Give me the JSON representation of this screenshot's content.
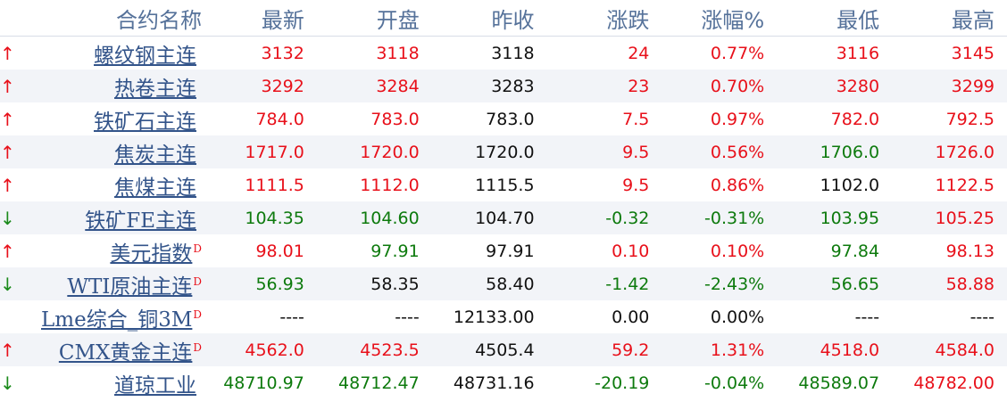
{
  "headers": {
    "name": "合约名称",
    "last": "最新",
    "open": "开盘",
    "prev": "昨收",
    "change": "涨跌",
    "pct": "涨幅%",
    "low": "最低",
    "high": "最高"
  },
  "colors": {
    "up": "#e8101a",
    "down": "#0d7a0d",
    "flat": "#111111",
    "header": "#56729a",
    "link": "#33548a"
  },
  "rows": [
    {
      "trend": "up",
      "arrow": "↑",
      "name": "螺纹钢主连",
      "tag": "",
      "last": "3132",
      "open": "3118",
      "prev": "3118",
      "change": "24",
      "pct": "0.77%",
      "low": "3116",
      "high": "3145",
      "c_last": "red",
      "c_open": "red",
      "c_change": "red",
      "c_pct": "red",
      "c_low": "red",
      "c_high": "red"
    },
    {
      "trend": "up",
      "arrow": "↑",
      "name": "热卷主连",
      "tag": "",
      "last": "3292",
      "open": "3284",
      "prev": "3283",
      "change": "23",
      "pct": "0.70%",
      "low": "3280",
      "high": "3299",
      "c_last": "red",
      "c_open": "red",
      "c_change": "red",
      "c_pct": "red",
      "c_low": "red",
      "c_high": "red"
    },
    {
      "trend": "up",
      "arrow": "↑",
      "name": "铁矿石主连",
      "tag": "",
      "last": "784.0",
      "open": "783.0",
      "prev": "783.0",
      "change": "7.5",
      "pct": "0.97%",
      "low": "782.0",
      "high": "792.5",
      "c_last": "red",
      "c_open": "red",
      "c_change": "red",
      "c_pct": "red",
      "c_low": "red",
      "c_high": "red"
    },
    {
      "trend": "up",
      "arrow": "↑",
      "name": "焦炭主连",
      "tag": "",
      "last": "1717.0",
      "open": "1720.0",
      "prev": "1720.0",
      "change": "9.5",
      "pct": "0.56%",
      "low": "1706.0",
      "high": "1726.0",
      "c_last": "red",
      "c_open": "red",
      "c_change": "red",
      "c_pct": "red",
      "c_low": "green",
      "c_high": "red"
    },
    {
      "trend": "up",
      "arrow": "↑",
      "name": "焦煤主连",
      "tag": "",
      "last": "1111.5",
      "open": "1112.0",
      "prev": "1115.5",
      "change": "9.5",
      "pct": "0.86%",
      "low": "1102.0",
      "high": "1122.5",
      "c_last": "red",
      "c_open": "red",
      "c_change": "red",
      "c_pct": "red",
      "c_low": "black",
      "c_high": "red"
    },
    {
      "trend": "down",
      "arrow": "↓",
      "name": "铁矿FE主连",
      "tag": "",
      "last": "104.35",
      "open": "104.60",
      "prev": "104.70",
      "change": "-0.32",
      "pct": "-0.31%",
      "low": "103.95",
      "high": "105.25",
      "c_last": "green",
      "c_open": "green",
      "c_change": "green",
      "c_pct": "green",
      "c_low": "green",
      "c_high": "red"
    },
    {
      "trend": "up",
      "arrow": "↑",
      "name": "美元指数",
      "tag": "D",
      "last": "98.01",
      "open": "97.91",
      "prev": "97.91",
      "change": "0.10",
      "pct": "0.10%",
      "low": "97.84",
      "high": "98.13",
      "c_last": "red",
      "c_open": "green",
      "c_change": "red",
      "c_pct": "red",
      "c_low": "green",
      "c_high": "red"
    },
    {
      "trend": "down",
      "arrow": "↓",
      "name": "WTI原油主连",
      "tag": "D",
      "last": "56.93",
      "open": "58.35",
      "prev": "58.40",
      "change": "-1.42",
      "pct": "-2.43%",
      "low": "56.65",
      "high": "58.88",
      "c_last": "green",
      "c_open": "black",
      "c_change": "green",
      "c_pct": "green",
      "c_low": "green",
      "c_high": "red"
    },
    {
      "trend": "flat",
      "arrow": "",
      "name": "Lme综合_铜3M",
      "tag": "D",
      "last": "----",
      "open": "----",
      "prev": "12133.00",
      "change": "0.00",
      "pct": "0.00%",
      "low": "----",
      "high": "----",
      "c_last": "black",
      "c_open": "black",
      "c_change": "black",
      "c_pct": "black",
      "c_low": "black",
      "c_high": "black"
    },
    {
      "trend": "up",
      "arrow": "↑",
      "name": "CMX黄金主连",
      "tag": "D",
      "last": "4562.0",
      "open": "4523.5",
      "prev": "4505.4",
      "change": "59.2",
      "pct": "1.31%",
      "low": "4518.0",
      "high": "4584.0",
      "c_last": "red",
      "c_open": "red",
      "c_change": "red",
      "c_pct": "red",
      "c_low": "red",
      "c_high": "red"
    },
    {
      "trend": "down",
      "arrow": "↓",
      "name": "道琼工业",
      "tag": "",
      "last": "48710.97",
      "open": "48712.47",
      "prev": "48731.16",
      "change": "-20.19",
      "pct": "-0.04%",
      "low": "48589.07",
      "high": "48782.00",
      "c_last": "green",
      "c_open": "green",
      "c_change": "green",
      "c_pct": "green",
      "c_low": "green",
      "c_high": "red"
    }
  ]
}
